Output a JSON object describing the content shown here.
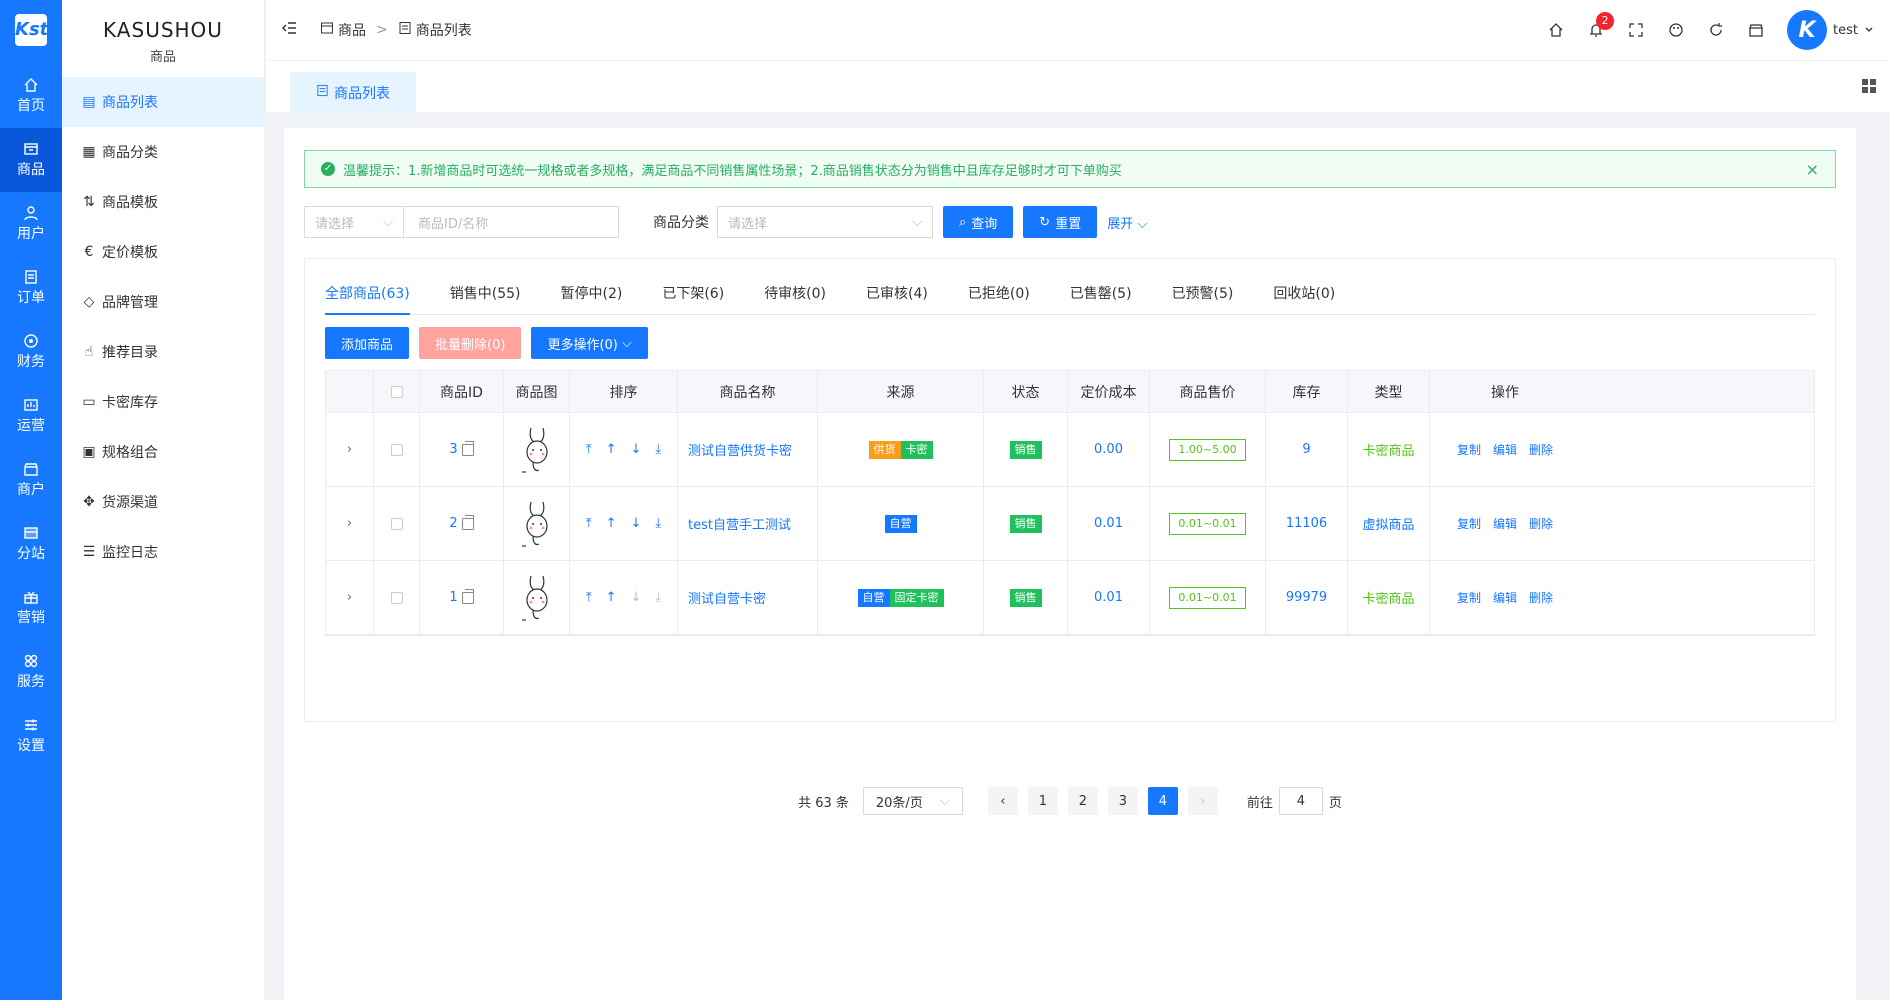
{
  "app": {
    "logo": "Kst",
    "brand": "KASUSHOU",
    "section": "商品"
  },
  "left_nav": [
    {
      "label": "首页",
      "icon": "home-icon"
    },
    {
      "label": "商品",
      "icon": "goods-icon",
      "active": true
    },
    {
      "label": "用户",
      "icon": "user-icon"
    },
    {
      "label": "订单",
      "icon": "order-icon"
    },
    {
      "label": "财务",
      "icon": "finance-icon"
    },
    {
      "label": "运营",
      "icon": "operation-icon"
    },
    {
      "label": "商户",
      "icon": "merchant-icon"
    },
    {
      "label": "分站",
      "icon": "substation-icon"
    },
    {
      "label": "营销",
      "icon": "gift-icon"
    },
    {
      "label": "服务",
      "icon": "service-icon"
    },
    {
      "label": "设置",
      "icon": "settings-icon"
    }
  ],
  "sidebar": [
    {
      "label": "商品列表",
      "icon": "list-icon",
      "active": true
    },
    {
      "label": "商品分类",
      "icon": "category-icon"
    },
    {
      "label": "商品模板",
      "icon": "template-icon"
    },
    {
      "label": "定价模板",
      "icon": "pricing-icon"
    },
    {
      "label": "品牌管理",
      "icon": "tag-icon"
    },
    {
      "label": "推荐目录",
      "icon": "thumb-icon"
    },
    {
      "label": "卡密库存",
      "icon": "card-icon"
    },
    {
      "label": "规格组合",
      "icon": "spec-icon"
    },
    {
      "label": "货源渠道",
      "icon": "source-icon"
    },
    {
      "label": "监控日志",
      "icon": "log-icon"
    }
  ],
  "header": {
    "breadcrumb": [
      "商品",
      "商品列表"
    ],
    "sep": ">",
    "notif_count": "2",
    "user": "test",
    "avatar": "K"
  },
  "tab": {
    "label": "商品列表"
  },
  "alert": {
    "text": "温馨提示：1.新增商品时可选统一规格或者多规格，满足商品不同销售属性场景；2.商品销售状态分为销售中且库存足够时才可下单购买",
    "close": "×"
  },
  "filters": {
    "select_placeholder": "请选择",
    "search_placeholder": "商品ID/名称",
    "category_label": "商品分类",
    "category_placeholder": "请选择",
    "query": "查询",
    "reset": "重置",
    "expand": "展开"
  },
  "status_tabs": [
    "全部商品(63)",
    "销售中(55)",
    "暂停中(2)",
    "已下架(6)",
    "待审核(0)",
    "已审核(4)",
    "已拒绝(0)",
    "已售罄(5)",
    "已预警(5)",
    "回收站(0)"
  ],
  "actions": {
    "add": "添加商品",
    "batch_delete": "批量删除(0)",
    "more": "更多操作(0)"
  },
  "table": {
    "headers": [
      "商品ID",
      "商品图",
      "排序",
      "商品名称",
      "来源",
      "状态",
      "定价成本",
      "商品售价",
      "库存",
      "类型",
      "操作"
    ],
    "rows": [
      {
        "id": "3",
        "name": "测试自营供货卡密",
        "tags": [
          {
            "t": "供货",
            "c": "o"
          },
          {
            "t": "卡密",
            "c": "g"
          }
        ],
        "status": "销售",
        "cost": "0.00",
        "price": "1.00~5.00",
        "stock": "9",
        "type": "卡密商品",
        "type_color": "green"
      },
      {
        "id": "2",
        "name": "test自营手工测试",
        "tags": [
          {
            "t": "自营",
            "c": "b"
          }
        ],
        "status": "销售",
        "cost": "0.01",
        "price": "0.01~0.01",
        "stock": "11106",
        "type": "虚拟商品",
        "type_color": "blue"
      },
      {
        "id": "1",
        "name": "测试自营卡密",
        "tags": [
          {
            "t": "自营",
            "c": "b"
          },
          {
            "t": "固定卡密",
            "c": "g"
          }
        ],
        "status": "销售",
        "cost": "0.01",
        "price": "0.01~0.01",
        "stock": "99979",
        "type": "卡密商品",
        "type_color": "green"
      }
    ],
    "ops": [
      "复制",
      "编辑",
      "删除"
    ]
  },
  "pager": {
    "total": "共 63 条",
    "size": "20条/页",
    "pages": [
      "1",
      "2",
      "3",
      "4"
    ],
    "current": "4",
    "goto": "前往",
    "goto_value": "4",
    "page_unit": "页"
  }
}
